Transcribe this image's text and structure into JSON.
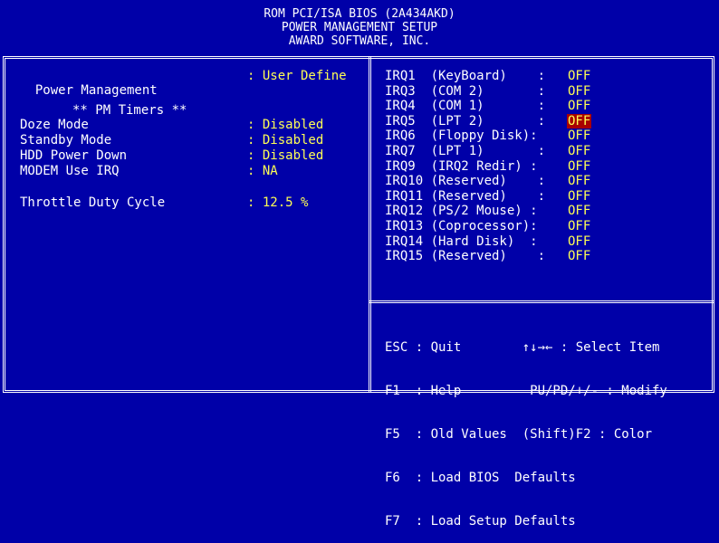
{
  "header": {
    "line1": "ROM PCI/ISA BIOS (2A434AKD)",
    "line2": "POWER MANAGEMENT SETUP",
    "line3": "AWARD SOFTWARE, INC."
  },
  "left": {
    "power_management": {
      "label": "Power Management",
      "value": ": User Define"
    },
    "pm_timers_heading": "** PM Timers **",
    "doze_mode": {
      "label": "Doze Mode",
      "value": ": Disabled"
    },
    "standby_mode": {
      "label": "Standby Mode",
      "value": ": Disabled"
    },
    "hdd_power_down": {
      "label": "HDD Power Down",
      "value": ": Disabled"
    },
    "modem_use_irq": {
      "label": "MODEM Use IRQ",
      "value": ": NA"
    },
    "throttle_duty_cycle": {
      "label": "Throttle Duty Cycle",
      "value": ": 12.5 %"
    }
  },
  "irqs": [
    {
      "label": "IRQ1  (KeyBoard)    :",
      "value": "OFF",
      "selected": false
    },
    {
      "label": "IRQ3  (COM 2)       :",
      "value": "OFF",
      "selected": false
    },
    {
      "label": "IRQ4  (COM 1)       :",
      "value": "OFF",
      "selected": false
    },
    {
      "label": "IRQ5  (LPT 2)       :",
      "value": "OFF",
      "selected": true
    },
    {
      "label": "IRQ6  (Floppy Disk):",
      "value": "OFF",
      "selected": false
    },
    {
      "label": "IRQ7  (LPT 1)       :",
      "value": "OFF",
      "selected": false
    },
    {
      "label": "IRQ9  (IRQ2 Redir) :",
      "value": "OFF",
      "selected": false
    },
    {
      "label": "IRQ10 (Reserved)    :",
      "value": "OFF",
      "selected": false
    },
    {
      "label": "IRQ11 (Reserved)    :",
      "value": "OFF",
      "selected": false
    },
    {
      "label": "IRQ12 (PS/2 Mouse) :",
      "value": "OFF",
      "selected": false
    },
    {
      "label": "IRQ13 (Coprocessor):",
      "value": "OFF",
      "selected": false
    },
    {
      "label": "IRQ14 (Hard Disk)  :",
      "value": "OFF",
      "selected": false
    },
    {
      "label": "IRQ15 (Reserved)    :",
      "value": "OFF",
      "selected": false
    }
  ],
  "help": {
    "l1": "ESC : Quit        ↑↓→← : Select Item",
    "l2": "F1  : Help         PU/PD/+/- : Modify",
    "l3": "F5  : Old Values  (Shift)F2 : Color",
    "l4": "F6  : Load BIOS  Defaults",
    "l5": "F7  : Load Setup Defaults"
  },
  "colors": {
    "background": "#0000a8",
    "value": "#ffff55",
    "selection": "#a80000",
    "text": "#ffffff"
  }
}
